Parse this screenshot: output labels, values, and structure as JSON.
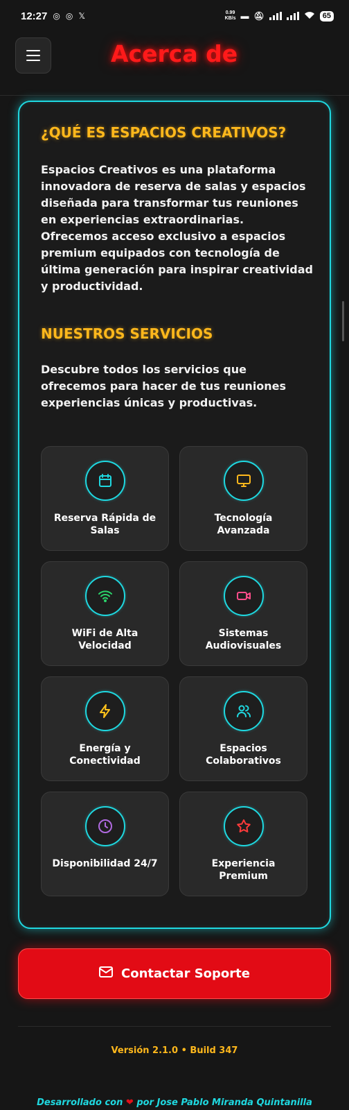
{
  "status_bar": {
    "time": "12:27",
    "net_speed_value": "0.99",
    "net_speed_unit": "KB/s",
    "battery": "65"
  },
  "header": {
    "title": "Acerca de"
  },
  "about": {
    "title": "¿QUÉ ES ESPACIOS CREATIVOS?",
    "text": "Espacios Creativos es una plataforma innovadora de reserva de salas y espacios diseñada para transformar tus reuniones en experiencias extraordinarias. Ofrecemos acceso exclusivo a espacios premium equipados con tecnología de última generación para inspirar creatividad y productividad."
  },
  "services": {
    "title": "NUESTROS SERVICIOS",
    "intro": "Descubre todos los servicios que ofrecemos para hacer de tus reuniones experiencias únicas y productivas.",
    "items": [
      {
        "label": "Reserva Rápida de Salas",
        "icon": "calendar-icon",
        "color": "#1fd8e0"
      },
      {
        "label": "Tecnología Avanzada",
        "icon": "monitor-icon",
        "color": "#ffb81c"
      },
      {
        "label": "WiFi de Alta Velocidad",
        "icon": "wifi-icon",
        "color": "#2bd46b"
      },
      {
        "label": "Sistemas Audiovisuales",
        "icon": "video-icon",
        "color": "#ff4d8a"
      },
      {
        "label": "Energía y Conectividad",
        "icon": "lightning-icon",
        "color": "#ffc21c"
      },
      {
        "label": "Espacios Colaborativos",
        "icon": "users-icon",
        "color": "#1fd8e0"
      },
      {
        "label": "Disponibilidad 24/7",
        "icon": "clock-icon",
        "color": "#b06ae0"
      },
      {
        "label": "Experiencia Premium",
        "icon": "star-icon",
        "color": "#ff3b3b"
      }
    ]
  },
  "support_button": {
    "label": "Contactar Soporte",
    "icon": "mail-icon"
  },
  "footer": {
    "version": "Versión 2.1.0 • Build 347",
    "credits_prefix": "Desarrollado con",
    "credits_suffix": "por Jose Pablo Miranda Quintanilla"
  },
  "colors": {
    "accent_cyan": "#1fd8e0",
    "accent_yellow": "#ffb81c",
    "accent_red": "#e20b15",
    "background": "#161616"
  }
}
